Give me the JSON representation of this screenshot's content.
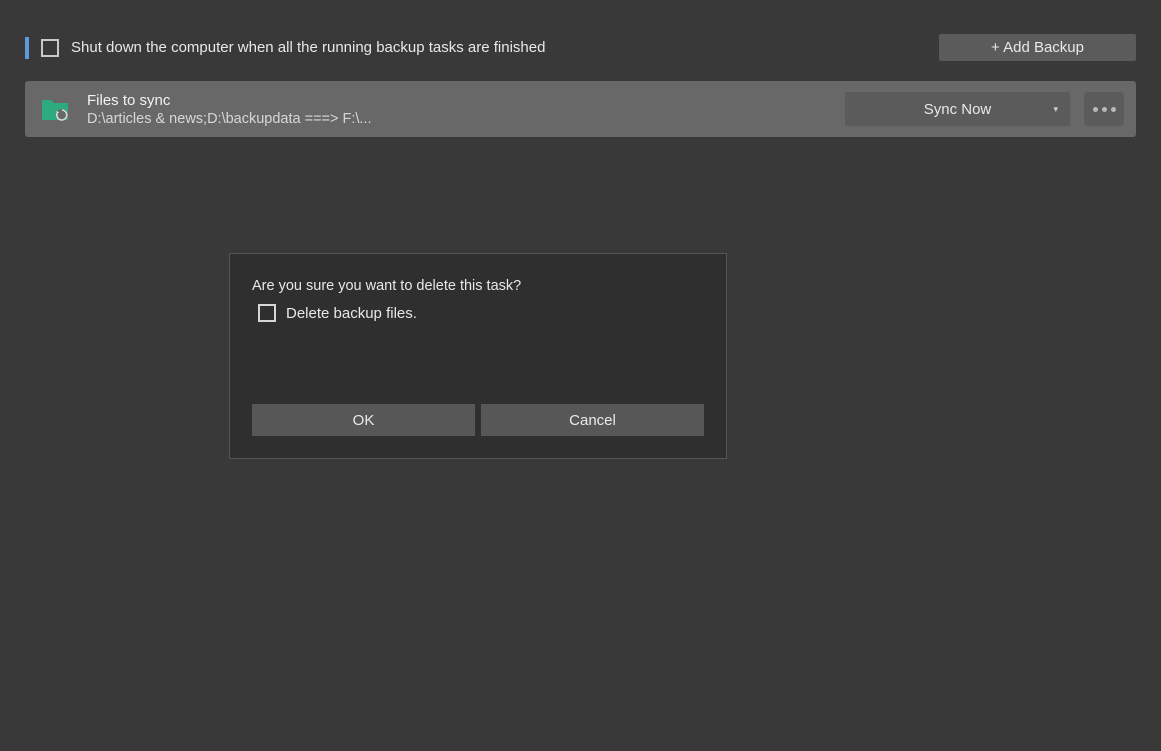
{
  "header": {
    "shutdown_label": "Shut down the computer when all the running backup tasks are finished",
    "add_backup_label": "+ Add Backup"
  },
  "task": {
    "title": "Files to sync",
    "path": "D:\\articles & news;D:\\backupdata ===> F:\\...",
    "sync_label": "Sync Now",
    "icon_name": "sync-folder-icon"
  },
  "dialog": {
    "message": "Are you sure you want to delete this task?",
    "checkbox_label": "Delete backup files.",
    "ok_label": "OK",
    "cancel_label": "Cancel"
  }
}
